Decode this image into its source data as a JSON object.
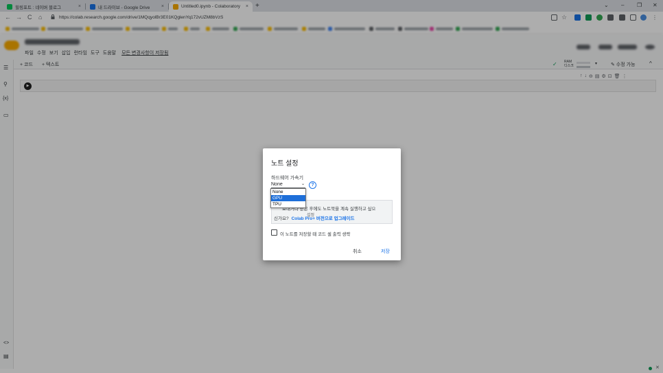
{
  "browser": {
    "tabs": [
      {
        "title": "힐링포트 : 네이버 블로그",
        "fav_color": "#03c75a"
      },
      {
        "title": "내 드라이브 - Google Drive",
        "fav_color": "#1a73e8"
      },
      {
        "title": "Untitled0.ipynb - Colaboratory",
        "fav_color": "#f9ab00"
      }
    ],
    "tab_close": "×",
    "new_tab": "+",
    "window": {
      "chevron": "⌄",
      "minimize": "–",
      "restore": "❐",
      "close": "✕"
    },
    "nav": {
      "back": "←",
      "forward": "→",
      "reload": "C",
      "home": "⌂"
    },
    "url": "https://colab.research.google.com/drive/1MQqyolBr3E01KQglenYq172vUZM8bVzS"
  },
  "colab": {
    "menu": [
      "파일",
      "수정",
      "보기",
      "삽입",
      "런타임",
      "도구",
      "도움말"
    ],
    "saved_notice": "모든 변경사항이 저장됨",
    "add_code": "+ 코드",
    "add_text": "+ 텍스트",
    "ram_label": "RAM",
    "disk_label": "디스크",
    "edit_mode": "✎ 수정 가능",
    "sidebar_icons": [
      "☰",
      "⚲",
      "{x}",
      "▭",
      "<>",
      "▤"
    ],
    "run_icon": "▶",
    "cell_tools": [
      "↑",
      "↓",
      "⊖",
      "▤",
      "⚙",
      "⊡",
      "🗑",
      "⋮"
    ]
  },
  "dialog": {
    "title": "노트 설정",
    "hw_label": "하드웨어 가속기",
    "selected": "None",
    "caret": "⌄",
    "help": "?",
    "options": [
      "None",
      "GPU",
      "TPU"
    ],
    "highlighted_option": "GPU",
    "partial_text": "설정",
    "info_line1": "보내거나 닫은 후에도 노트북을 계속 실행하고 싶으",
    "info_line2": "신가요?",
    "upgrade_link": "Colab Pro+ 버전으로 업그레이드",
    "checkbox_label": "이 노트를 저장할 때 코드 셀 출력 생략",
    "cancel": "취소",
    "save": "저장"
  }
}
